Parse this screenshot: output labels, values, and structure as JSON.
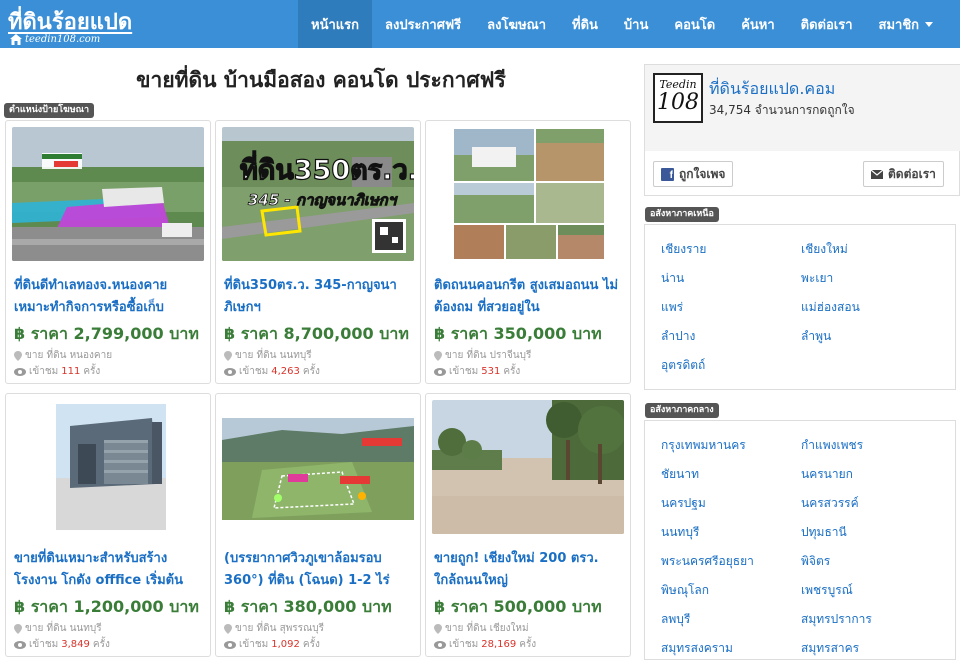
{
  "brand": {
    "logo_text": "ที่ดินร้อยแปด",
    "logo_url": "teedin108.com"
  },
  "nav": {
    "items": [
      {
        "label": "หน้าแรก",
        "active": true
      },
      {
        "label": "ลงประกาศฟรี"
      },
      {
        "label": "ลงโฆษณา"
      },
      {
        "label": "ที่ดิน"
      },
      {
        "label": "บ้าน"
      },
      {
        "label": "คอนโด"
      },
      {
        "label": "ค้นหา"
      },
      {
        "label": "ติดต่อเรา"
      },
      {
        "label": "สมาชิก",
        "dropdown": true
      }
    ]
  },
  "main": {
    "headline": "ขายที่ดิน บ้านมือสอง คอนโด ประกาศฟรี",
    "ad_tag": "ตำแหน่งป้ายโฆษณา",
    "listings": [
      {
        "title": "ที่ดินดีทำเลทองจ.หนองคาย เหมาะทำกิจการหรือซื้อเก็บ",
        "price": "฿ ราคา 2,799,000 บาท",
        "location": "ขาย ที่ดิน หนองคาย",
        "views_label": "เข้าชม",
        "views": "111",
        "views_unit": "ครั้ง"
      },
      {
        "title": "ที่ดิน350ตร.ว. 345-กาญจนาภิเษกฯ",
        "price": "฿ ราคา 8,700,000 บาท",
        "location": "ขาย ที่ดิน นนทบุรี",
        "views_label": "เข้าชม",
        "views": "4,263",
        "views_unit": "ครั้ง",
        "image_text": {
          "big": "ที่ดิน350ตร.ว.",
          "road": "345 - กาญจนาภิเษกฯ"
        }
      },
      {
        "title": "ติดถนนคอนกรีต สูงเสมอถนน ไม่ต้องถม ที่สวยอยู่ใน",
        "price": "฿ ราคา 350,000 บาท",
        "location": "ขาย ที่ดิน ปราจีนบุรี",
        "views_label": "เข้าชม",
        "views": "531",
        "views_unit": "ครั้ง"
      },
      {
        "title": "ขายที่ดินเหมาะสำหรับสร้างโรงงาน โกดัง offfice เริ่มต้น",
        "price": "฿ ราคา 1,200,000 บาท",
        "location": "ขาย ที่ดิน นนทบุรี",
        "views_label": "เข้าชม",
        "views": "3,849",
        "views_unit": "ครั้ง"
      },
      {
        "title": "(บรรยากาศวิวภูเขาล้อมรอบ 360°) ที่ดิน (โฉนด) 1-2 ไร่",
        "price": "฿ ราคา 380,000 บาท",
        "location": "ขาย ที่ดิน สุพรรณบุรี",
        "views_label": "เข้าชม",
        "views": "1,092",
        "views_unit": "ครั้ง"
      },
      {
        "title": "ขายถูก! เชียงใหม่ 200 ตรว. ใกล้ถนนใหญ่",
        "price": "฿ ราคา 500,000 บาท",
        "location": "ขาย ที่ดิน เชียงใหม่",
        "views_label": "เข้าชม",
        "views": "28,169",
        "views_unit": "ครั้ง"
      }
    ]
  },
  "sidebar": {
    "fb": {
      "logo_top": "Teedin",
      "logo_bottom": "108",
      "name": "ที่ดินร้อยแปด.คอม",
      "likes": "34,754 จำนวนการกดถูกใจ",
      "like_button": "ถูกใจเพจ",
      "contact_button": "ติดต่อเรา"
    },
    "north": {
      "tag": "อสังหาภาคเหนือ",
      "provinces": [
        "เชียงราย",
        "เชียงใหม่",
        "น่าน",
        "พะเยา",
        "แพร่",
        "แม่ฮ่องสอน",
        "ลำปาง",
        "ลำพูน",
        "อุตรดิตถ์"
      ]
    },
    "central": {
      "tag": "อสังหาภาคกลาง",
      "provinces": [
        "กรุงเทพมหานคร",
        "กำแพงเพชร",
        "ชัยนาท",
        "นครนายก",
        "นครปฐม",
        "นครสวรรค์",
        "นนทบุรี",
        "ปทุมธานี",
        "พระนครศรีอยุธยา",
        "พิจิตร",
        "พิษณุโลก",
        "เพชรบูรณ์",
        "ลพบุรี",
        "สมุทรปราการ",
        "สมุทรสงคราม",
        "สมุทรสาคร"
      ]
    }
  },
  "colors": {
    "nav_bg": "#3a8fd6",
    "nav_active": "#2f7cbd",
    "link": "#1a6fc4",
    "price": "#3a7d38",
    "views": "#d9342b"
  }
}
